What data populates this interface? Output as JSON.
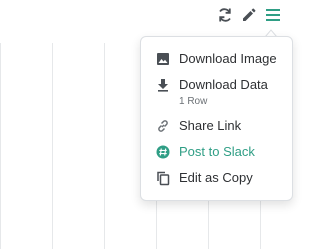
{
  "toolbar": {
    "icons": [
      "refresh-icon",
      "pencil-icon",
      "menu-icon"
    ],
    "accent_color": "#2f9e85",
    "icon_color": "#4a4f55"
  },
  "menu": {
    "items": [
      {
        "label": "Download Image",
        "icon": "image-icon"
      },
      {
        "label": "Download Data",
        "sublabel": "1 Row",
        "icon": "download-icon"
      },
      {
        "label": "Share Link",
        "icon": "link-icon"
      },
      {
        "label": "Post to Slack",
        "icon": "slack-icon",
        "color": "#2f9e85"
      },
      {
        "label": "Edit as Copy",
        "icon": "copy-icon"
      }
    ]
  }
}
